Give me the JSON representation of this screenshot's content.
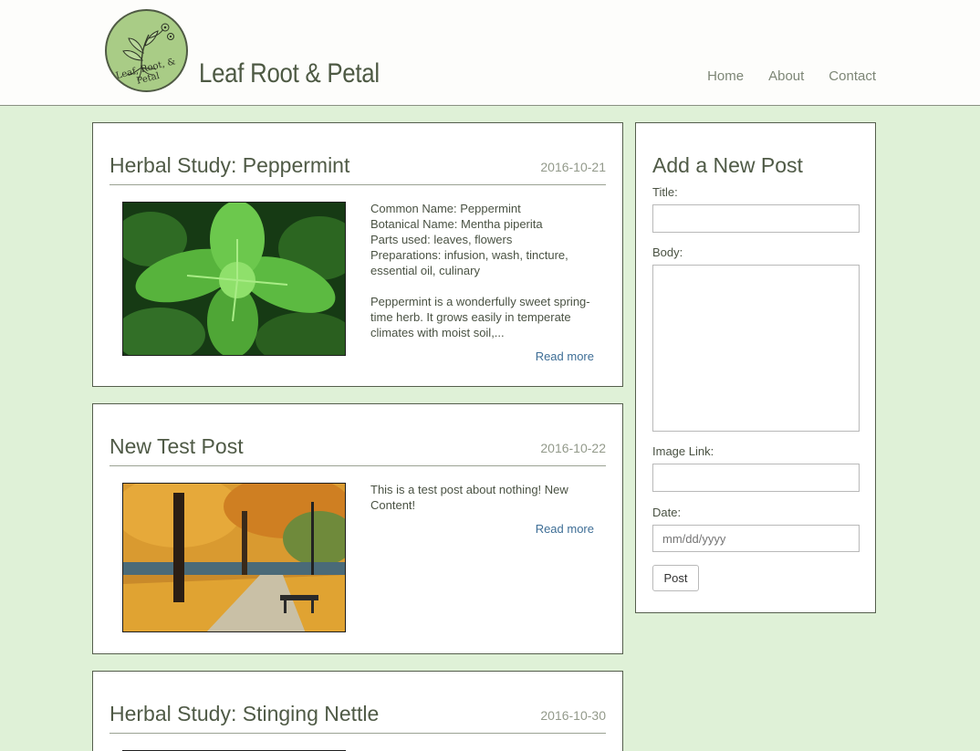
{
  "header": {
    "logo_text": "Leaf, Root, & Petal",
    "site_title": "Leaf Root & Petal",
    "nav": [
      "Home",
      "About",
      "Contact"
    ]
  },
  "posts": [
    {
      "title": "Herbal Study: Peppermint",
      "date": "2016-10-21",
      "lines": [
        "Common Name: Peppermint",
        "Botanical Name: Mentha piperita",
        "Parts used: leaves, flowers",
        "Preparations: infusion, wash, tincture, essential oil, culinary"
      ],
      "excerpt": "Peppermint is a wonderfully sweet spring-time herb. It grows easily in temperate climates with moist soil,...",
      "read_more": "Read more"
    },
    {
      "title": "New Test Post",
      "date": "2016-10-22",
      "excerpt": "This is a test post about nothing! New Content!",
      "read_more": "Read more"
    },
    {
      "title": "Herbal Study: Stinging Nettle",
      "date": "2016-10-30"
    }
  ],
  "form": {
    "heading": "Add a New Post",
    "title_label": "Title:",
    "body_label": "Body:",
    "image_label": "Image Link:",
    "date_label": "Date:",
    "date_placeholder": "mm/dd/yyyy",
    "submit_label": "Post"
  },
  "colors": {
    "page_bg": "#dff1d7",
    "link": "#3e6e96",
    "heading": "#4f5a46",
    "logo_green": "#a9cc86"
  }
}
